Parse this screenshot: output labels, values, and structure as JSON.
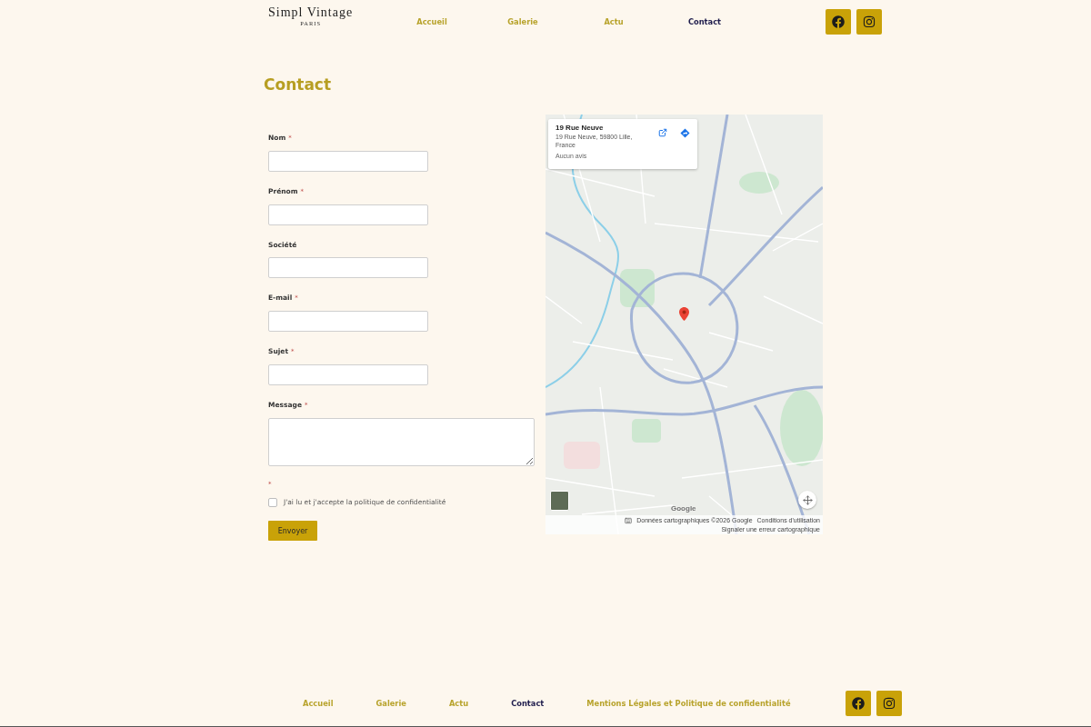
{
  "header": {
    "brand": {
      "name": "Simpl Vintage",
      "tagline": "PARIS"
    },
    "nav": [
      {
        "label": "Accueil",
        "selected": false
      },
      {
        "label": "Galerie",
        "selected": false
      },
      {
        "label": "Actu",
        "selected": false
      },
      {
        "label": "Contact",
        "selected": true
      }
    ]
  },
  "page_title": "Contact",
  "form": {
    "fields": [
      {
        "label": "Nom",
        "required_mark": "*",
        "kind": "text"
      },
      {
        "label": "Prénom",
        "required_mark": "*",
        "kind": "text"
      },
      {
        "label": "Société",
        "kind": "text"
      },
      {
        "label": "E-mail",
        "required_mark": "*",
        "kind": "text"
      },
      {
        "label": "Sujet",
        "required_mark": "*",
        "kind": "text"
      },
      {
        "label": "Message",
        "required_mark": "*",
        "kind": "textarea"
      }
    ],
    "consent": {
      "required_mark": "*",
      "label": "J'ai lu et j'accepte la politique de confidentialité",
      "checked": false
    },
    "submit": "Envoyer"
  },
  "map": {
    "place_card": {
      "title": "19 Rue Neuve",
      "address": "19 Rue Neuve, 59800 Lille, France",
      "reviews": "Aucun avis"
    },
    "logo": "Google",
    "attribution": "Données cartographiques ©2026 Google",
    "links": [
      "Conditions d'utilisation",
      "Signaler une erreur cartographique"
    ]
  },
  "footer": {
    "links": [
      {
        "label": "Accueil",
        "selected": false
      },
      {
        "label": "Galerie",
        "selected": false
      },
      {
        "label": "Actu",
        "selected": false
      },
      {
        "label": "Contact",
        "selected": true
      },
      {
        "label": "Mentions Légales et Politique de confidentialité",
        "selected": false
      }
    ]
  }
}
